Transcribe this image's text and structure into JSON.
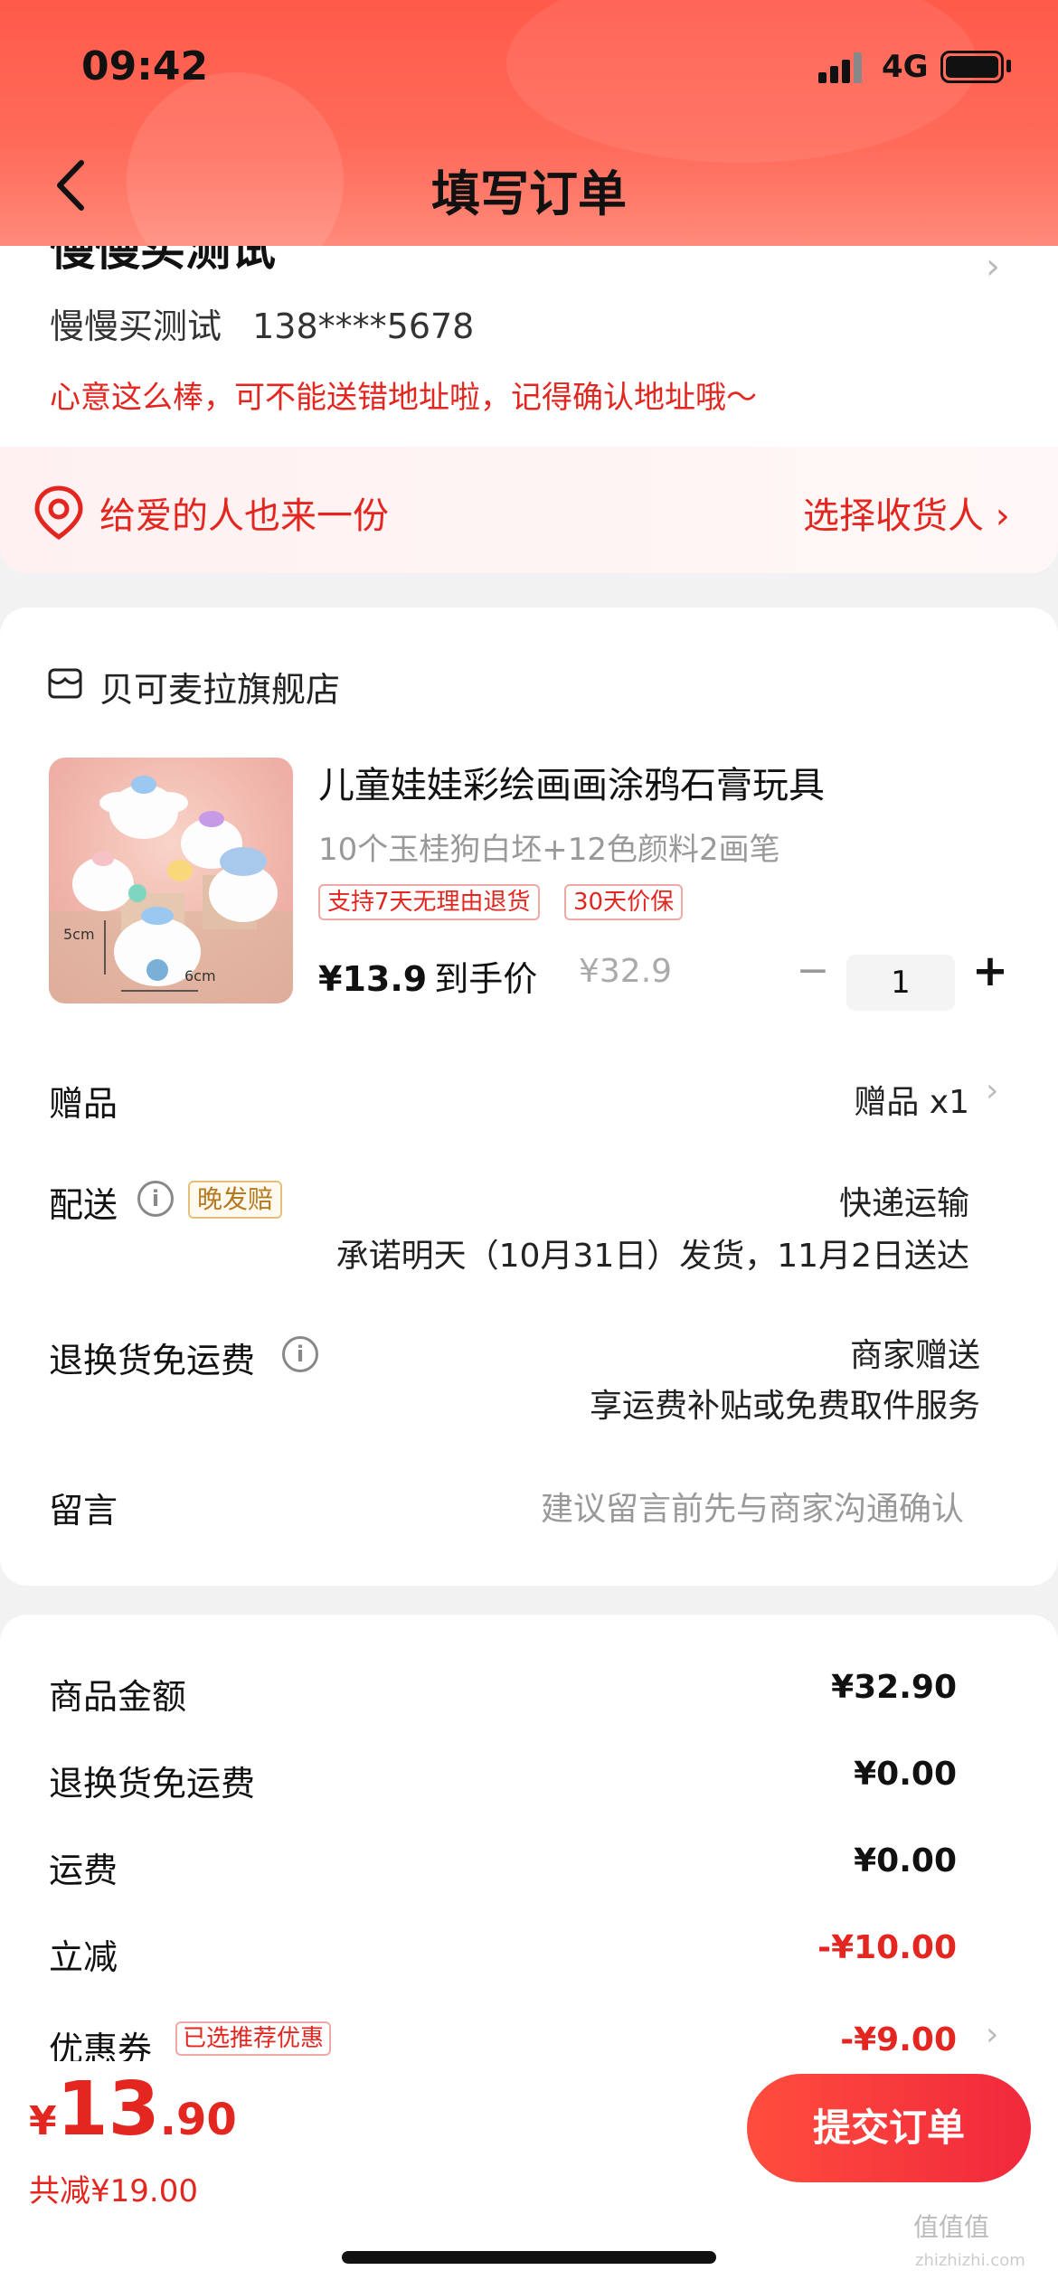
{
  "status_bar": {
    "time": "09:42",
    "network": "4G"
  },
  "nav": {
    "title": "填写订单"
  },
  "address": {
    "name_partial": "慢慢买测试",
    "contact_name": "慢慢买测试",
    "contact_phone": "138****5678",
    "warning": "心意这么棒，可不能送错地址啦，记得确认地址哦～"
  },
  "gift_bar": {
    "left_text": "给爱的人也来一份",
    "right_text": "选择收货人 ›"
  },
  "store": {
    "name": "贝可麦拉旗舰店"
  },
  "product": {
    "title": "儿童娃娃彩绘画画涂鸦石膏玩具",
    "spec": "10个玉桂狗白坯+12色颜料2画笔",
    "tags": [
      "支持7天无理由退货",
      "30天价保"
    ],
    "price": "¥13.9",
    "price_label": "到手价",
    "original_price": "¥32.9",
    "quantity": "1",
    "image_captions": {
      "height": "5cm",
      "width": "6cm"
    }
  },
  "rows": {
    "gift": {
      "label": "赠品",
      "value": "赠品 x1"
    },
    "delivery": {
      "label": "配送",
      "badge": "晚发赔",
      "method": "快递运输",
      "promise": "承诺明天（10月31日）发货，11月2日送达"
    },
    "return_free": {
      "label": "退换货免运费",
      "value": "商家赠送",
      "sub": "享运费补贴或免费取件服务"
    },
    "message": {
      "label": "留言",
      "placeholder": "建议留言前先与商家沟通确认"
    }
  },
  "summary": {
    "items": [
      {
        "label": "商品金额",
        "value": "¥32.90"
      },
      {
        "label": "退换货免运费",
        "value": "¥0.00"
      },
      {
        "label": "运费",
        "value": "¥0.00"
      },
      {
        "label": "立减",
        "value": "-¥10.00"
      },
      {
        "label": "优惠券",
        "value": "-¥9.00"
      }
    ],
    "coupon_tag": "已选推荐优惠"
  },
  "footer": {
    "total_yen": "¥",
    "total_int": "13",
    "total_dec": ".90",
    "saved": "共减¥19.00",
    "submit_label": "提交订单"
  },
  "watermark": {
    "main": "值值值",
    "sub": "zhizhizhi.com"
  },
  "colors": {
    "accent": "#e3261f",
    "header": "#ff5a4a"
  }
}
